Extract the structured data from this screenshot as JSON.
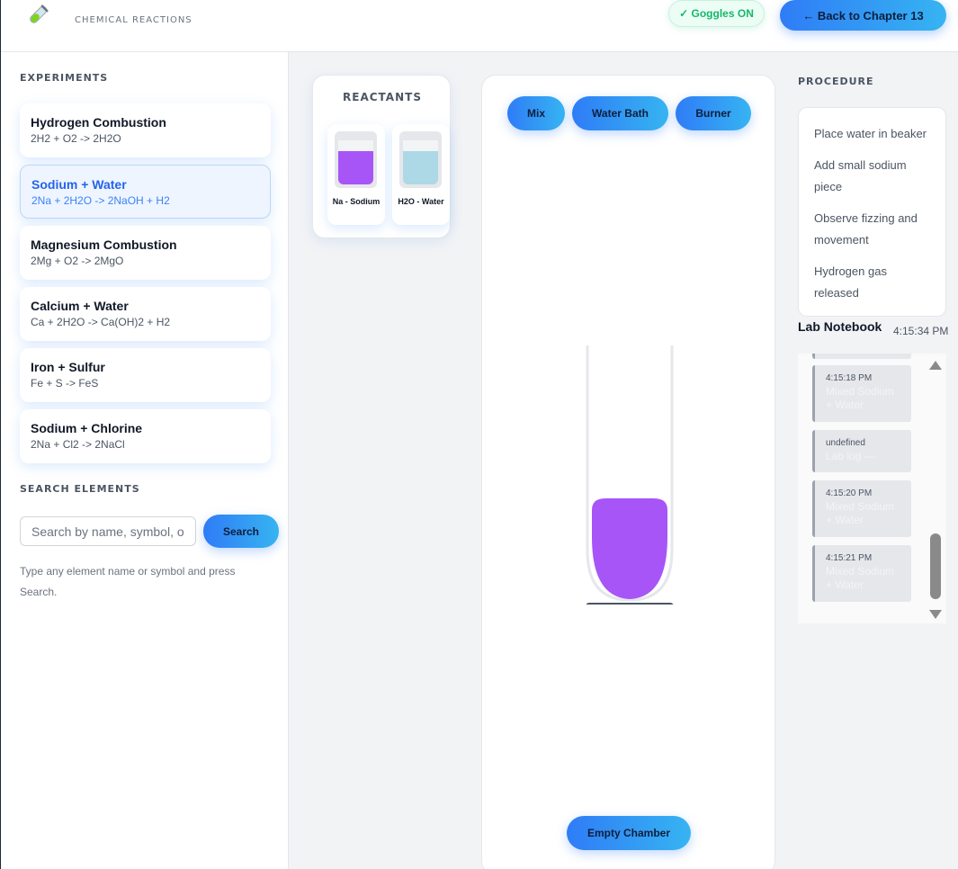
{
  "header": {
    "title": "CHEMICAL REACTIONS",
    "goggles_label": "✓ Goggles ON",
    "back_label": "← Back to Chapter 13"
  },
  "sidebar": {
    "experiments_label": "EXPERIMENTS",
    "experiments": [
      {
        "name": "Hydrogen Combustion",
        "equation": "2H2 + O2 -> 2H2O"
      },
      {
        "name": "Sodium + Water",
        "equation": "2Na + 2H2O -> 2NaOH + H2",
        "active": true
      },
      {
        "name": "Magnesium Combustion",
        "equation": "2Mg + O2 -> 2MgO"
      },
      {
        "name": "Calcium + Water",
        "equation": "Ca + 2H2O -> Ca(OH)2 + H2"
      },
      {
        "name": "Iron + Sulfur",
        "equation": "Fe + S -> FeS"
      },
      {
        "name": "Sodium + Chlorine",
        "equation": "2Na + Cl2 -> 2NaCl"
      }
    ],
    "search_label": "SEARCH ELEMENTS",
    "search_placeholder": "Search by name, symbol, or number",
    "search_button": "Search",
    "search_hint": "Type any element name or symbol and press Search."
  },
  "reactants": {
    "title": "REACTANTS",
    "items": [
      {
        "label": "Na - Sodium",
        "color": "#a855f7"
      },
      {
        "label": "H2O - Water",
        "color": "#add8e6"
      }
    ]
  },
  "chamber": {
    "buttons": {
      "mix": "Mix",
      "water_bath": "Water Bath",
      "burner": "Burner"
    },
    "liquid_color": "#a855f7",
    "empty_button": "Empty Chamber"
  },
  "procedure": {
    "label": "PROCEDURE",
    "steps": [
      "Place water in beaker",
      "Add small sodium piece",
      "Observe fizzing and movement",
      "Hydrogen gas released"
    ]
  },
  "notebook": {
    "title": "Lab Notebook",
    "time": "4:15:34 PM",
    "entries": [
      {
        "time": "4:15:18 PM",
        "note": "Mixed Sodium + Water"
      },
      {
        "time": "undefined",
        "note": "Lab log —"
      },
      {
        "time": "4:15:20 PM",
        "note": "Mixed Sodium + Water"
      },
      {
        "time": "4:15:21 PM",
        "note": "Mixed Sodium + Water"
      }
    ]
  },
  "colors": {
    "accent_start": "#2f7cf6",
    "accent_end": "#36b4f2",
    "goggles_green": "#15b86a"
  }
}
